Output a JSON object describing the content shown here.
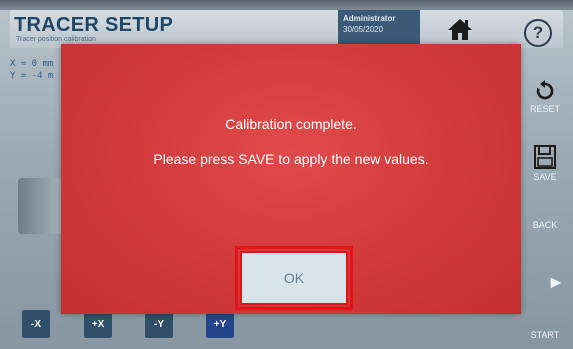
{
  "header": {
    "title": "TRACER SETUP",
    "subtitle": "Tracer position calibration",
    "user_name": "Administrator",
    "date": "30/05/2020"
  },
  "coords": {
    "x_label": "X = 0 mm",
    "y_label": "Y = -4 m"
  },
  "side_panel": {
    "reset_label": "RESET",
    "save_label": "SAVE",
    "back_label": "BACK",
    "start_label": "START"
  },
  "jog_buttons": [
    "-X",
    "+X",
    "-Y",
    "+Y"
  ],
  "dialog": {
    "line1": "Calibration complete.",
    "line2": "Please press SAVE to apply the new values.",
    "ok_label": "OK"
  },
  "colors": {
    "dialog_red": "#d23c3c",
    "highlight_red": "#e2141a",
    "header_blue": "#1f4666",
    "jog_blue": "#2f4f6b"
  },
  "icons": [
    "home-icon",
    "help-icon",
    "reset-icon",
    "save-icon",
    "chevron-right-icon"
  ]
}
